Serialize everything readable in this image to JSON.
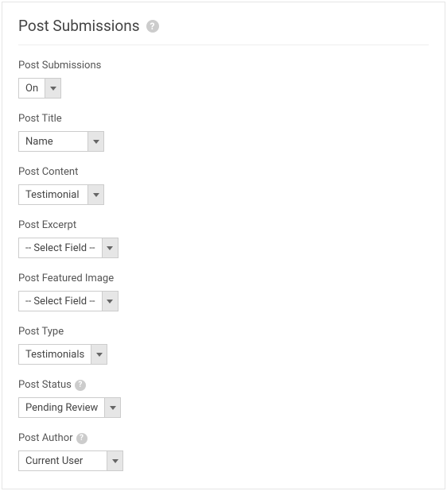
{
  "heading": "Post Submissions",
  "fields": {
    "post_submissions": {
      "label": "Post Submissions",
      "value": "On",
      "help": false
    },
    "post_title": {
      "label": "Post Title",
      "value": "Name",
      "help": false
    },
    "post_content": {
      "label": "Post Content",
      "value": "Testimonial",
      "help": false
    },
    "post_excerpt": {
      "label": "Post Excerpt",
      "value": "-- Select Field --",
      "help": false
    },
    "post_featured_image": {
      "label": "Post Featured Image",
      "value": "-- Select Field --",
      "help": false
    },
    "post_type": {
      "label": "Post Type",
      "value": "Testimonials",
      "help": false
    },
    "post_status": {
      "label": "Post Status",
      "value": "Pending Review",
      "help": true
    },
    "post_author": {
      "label": "Post Author",
      "value": "Current User",
      "help": true
    }
  }
}
